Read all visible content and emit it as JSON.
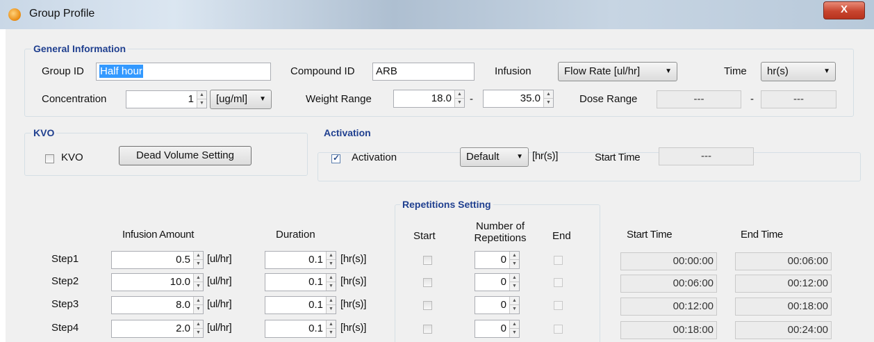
{
  "window": {
    "title": "Group Profile",
    "close_label": "X"
  },
  "general": {
    "title": "General Information",
    "group_id": {
      "label": "Group ID",
      "value": "Half hour"
    },
    "compound_id": {
      "label": "Compound ID",
      "value": "ARB"
    },
    "infusion": {
      "label": "Infusion",
      "value": "Flow Rate [ul/hr]"
    },
    "time": {
      "label": "Time",
      "value": "hr(s)"
    },
    "concentration": {
      "label": "Concentration",
      "value": "1",
      "unit": "[ug/ml]"
    },
    "weight_range": {
      "label": "Weight Range",
      "min": "18.0",
      "sep": "-",
      "max": "35.0"
    },
    "dose_range": {
      "label": "Dose Range",
      "min": "---",
      "sep": "-",
      "max": "---"
    }
  },
  "kvo": {
    "title": "KVO",
    "checkbox_label": "KVO",
    "checked": false,
    "button_label": "Dead Volume Setting"
  },
  "activation": {
    "title": "Activation",
    "checkbox_label": "Activation",
    "checked": true,
    "mode": "Default",
    "unit": "[hr(s)]",
    "start_time_label": "Start Time",
    "start_time": "---"
  },
  "repetitions": {
    "title": "Repetitions Setting"
  },
  "steps_header": {
    "infusion_amount": "Infusion Amount",
    "duration": "Duration",
    "start": "Start",
    "number_of_repetitions_1": "Number of",
    "number_of_repetitions_2": "Repetitions",
    "end": "End",
    "start_time": "Start Time",
    "end_time": "End Time"
  },
  "steps": [
    {
      "name": "Step1",
      "amount": "0.5",
      "amount_unit": "[ul/hr]",
      "duration": "0.1",
      "duration_unit": "[hr(s)]",
      "repetitions": "0",
      "start_time": "00:00:00",
      "end_time": "00:06:00"
    },
    {
      "name": "Step2",
      "amount": "10.0",
      "amount_unit": "[ul/hr]",
      "duration": "0.1",
      "duration_unit": "[hr(s)]",
      "repetitions": "0",
      "start_time": "00:06:00",
      "end_time": "00:12:00"
    },
    {
      "name": "Step3",
      "amount": "8.0",
      "amount_unit": "[ul/hr]",
      "duration": "0.1",
      "duration_unit": "[hr(s)]",
      "repetitions": "0",
      "start_time": "00:12:00",
      "end_time": "00:18:00"
    },
    {
      "name": "Step4",
      "amount": "2.0",
      "amount_unit": "[ul/hr]",
      "duration": "0.1",
      "duration_unit": "[hr(s)]",
      "repetitions": "0",
      "start_time": "00:18:00",
      "end_time": "00:24:00"
    }
  ],
  "icons": {
    "app": "app-icon",
    "spin_up": "spin-up-icon",
    "spin_down": "spin-down-icon",
    "dropdown": "chevron-down-icon"
  },
  "colors": {
    "group_title": "#1f3f8f",
    "selection": "#3399ff",
    "close": "#c8452f"
  }
}
